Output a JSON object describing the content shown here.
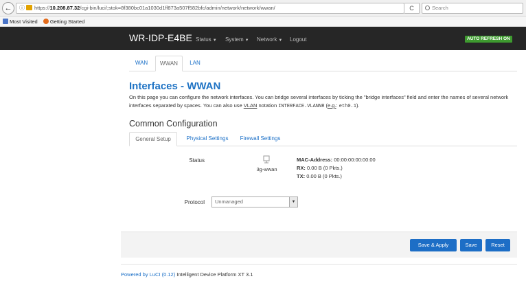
{
  "browser": {
    "back_icon": "back-arrow-icon",
    "info_icon": "info-icon",
    "lock_icon": "insecure-lock-icon",
    "url_prefix": "https://",
    "url_host": "10.208.87.32",
    "url_path": "/cgi-bin/luci/;stok=8f380bc01a1030d1ff873a507f582bfc/admin/network/network/wwan/",
    "reload_icon": "reload-icon",
    "reload_glyph": "C",
    "search_placeholder": "Search",
    "bookmarks": [
      {
        "label": "Most Visited",
        "icon": "star-icon"
      },
      {
        "label": "Getting Started",
        "icon": "firefox-icon"
      }
    ]
  },
  "header": {
    "brand": "WR-IDP-E4BE",
    "menus": [
      {
        "label": "Status"
      },
      {
        "label": "System"
      },
      {
        "label": "Network"
      },
      {
        "label": "Logout"
      }
    ],
    "auto_refresh": "AUTO REFRESH ON",
    "auto_refresh_color": "#3e9a2f"
  },
  "tabs": [
    {
      "label": "WAN",
      "active": false
    },
    {
      "label": "WWAN",
      "active": true
    },
    {
      "label": "LAN",
      "active": false
    }
  ],
  "page": {
    "title": "Interfaces - WWAN",
    "desc_part1": "On this page you can configure the network interfaces. You can bridge several interfaces by ticking the \"bridge interfaces\" field and enter the names of several network interfaces separated by spaces. You can also use ",
    "desc_vlan": "VLAN",
    "desc_part2": " notation ",
    "desc_code": "INTERFACE.VLANNR",
    "desc_part3": " (",
    "desc_eg": "e.g.",
    "desc_part4": ": ",
    "desc_example": "eth0.1",
    "desc_part5": ")."
  },
  "section": {
    "title": "Common Configuration",
    "tabs": [
      {
        "label": "General Setup",
        "active": true
      },
      {
        "label": "Physical Settings",
        "active": false
      },
      {
        "label": "Firewall Settings",
        "active": false
      }
    ]
  },
  "status": {
    "label": "Status",
    "iface_icon": "network-interface-icon",
    "iface_name": "3g-wwan",
    "mac_label": "MAC-Address:",
    "mac_value": "00:00:00:00:00:00",
    "rx_label": "RX:",
    "rx_value": "0.00 B (0 Pkts.)",
    "tx_label": "TX:",
    "tx_value": "0.00 B (0 Pkts.)"
  },
  "protocol": {
    "label": "Protocol",
    "value": "Unmanaged"
  },
  "actions": {
    "save_apply": "Save & Apply",
    "save": "Save",
    "reset": "Reset",
    "button_color": "#1d6ec6"
  },
  "footer": {
    "link": "Powered by LuCI (0.12)",
    "text": " Intelligent Device Platform XT 3.1"
  }
}
